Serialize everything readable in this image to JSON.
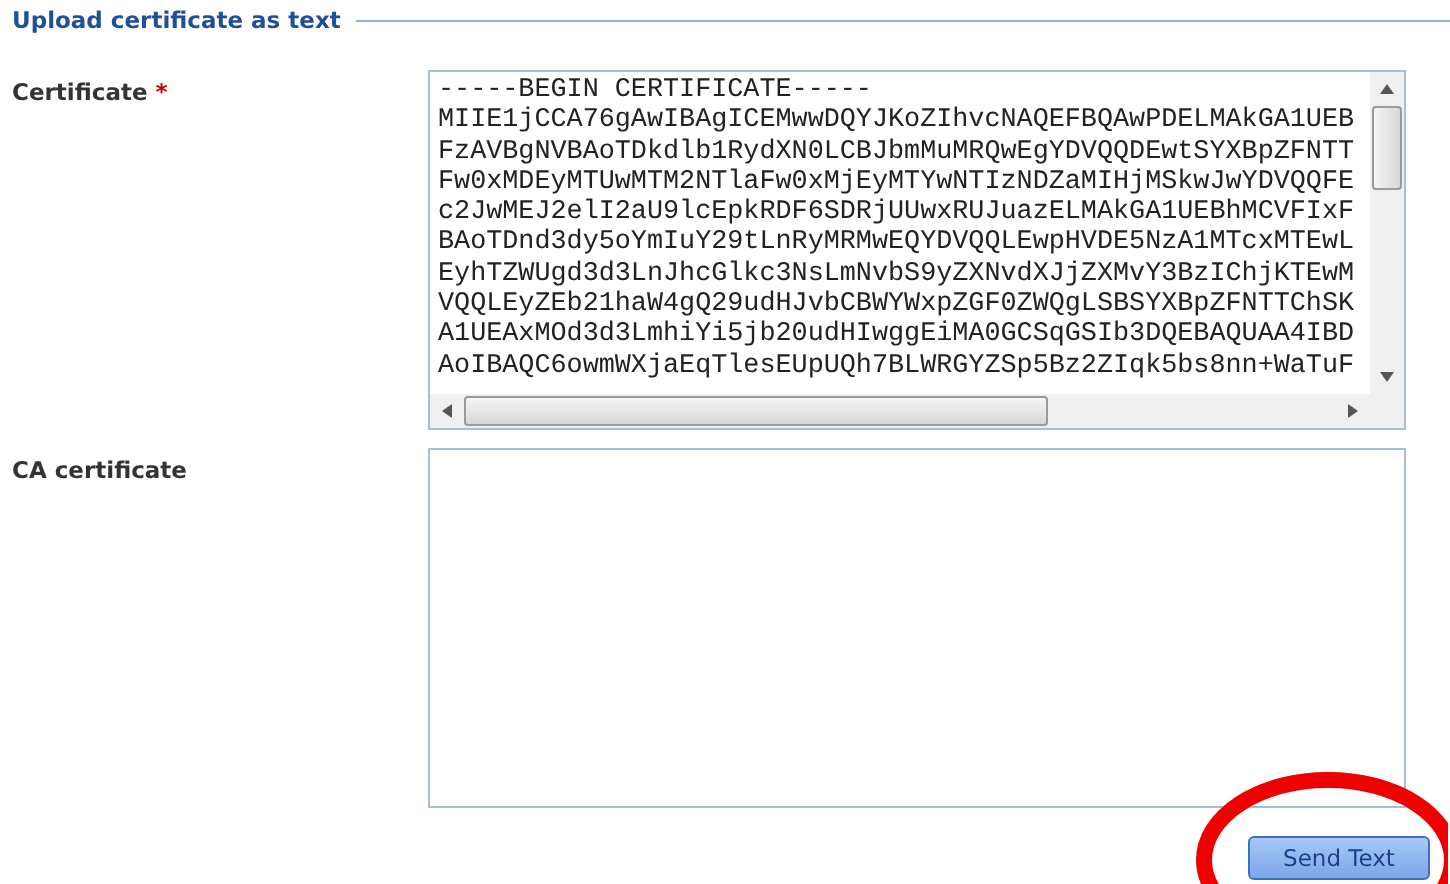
{
  "section": {
    "title": "Upload certificate as text"
  },
  "fields": [
    {
      "label": "Certificate",
      "required_mark": "*",
      "scrollbars": true,
      "lines": [
        "-----BEGIN CERTIFICATE-----",
        "MIIE1jCCA76gAwIBAgICEMwwDQYJKoZIhvcNAQEFBQAwPDELMAkGA1UEB",
        "FzAVBgNVBAoTDkdlb1RydXN0LCBJbmMuMRQwEgYDVQQDEwtSYXBpZFNTT",
        "Fw0xMDEyMTUwMTM2NTlaFw0xMjEyMTYwNTIzNDZaMIHjMSkwJwYDVQQFE",
        "c2JwMEJ2elI2aU9lcEpkRDF6SDRjUUwxRUJuazELMAkGA1UEBhMCVFIxF",
        "BAoTDnd3dy5oYmIuY29tLnRyMRMwEQYDVQQLEwpHVDE5NzA1MTcxMTEwL",
        "EyhTZWUgd3d3LnJhcGlkc3NsLmNvbS9yZXNvdXJjZXMvY3BzIChjKTEwM",
        "VQQLEyZEb21haW4gQ29udHJvbCBWYWxpZGF0ZWQgLSBSYXBpZFNTTChSK",
        "A1UEAxMOd3d3LmhiYi5jb20udHIwggEiMA0GCSqGSIb3DQEBAQUAA4IBD",
        "AoIBAQC6owmWXjaEqTlesEUpUQh7BLWRGYZSp5Bz2ZIqk5bs8nn+WaTuF"
      ]
    },
    {
      "label": "CA certificate",
      "scrollbars": false
    }
  ],
  "buttons": [
    {
      "label": "Send Text",
      "circled": true
    }
  ]
}
